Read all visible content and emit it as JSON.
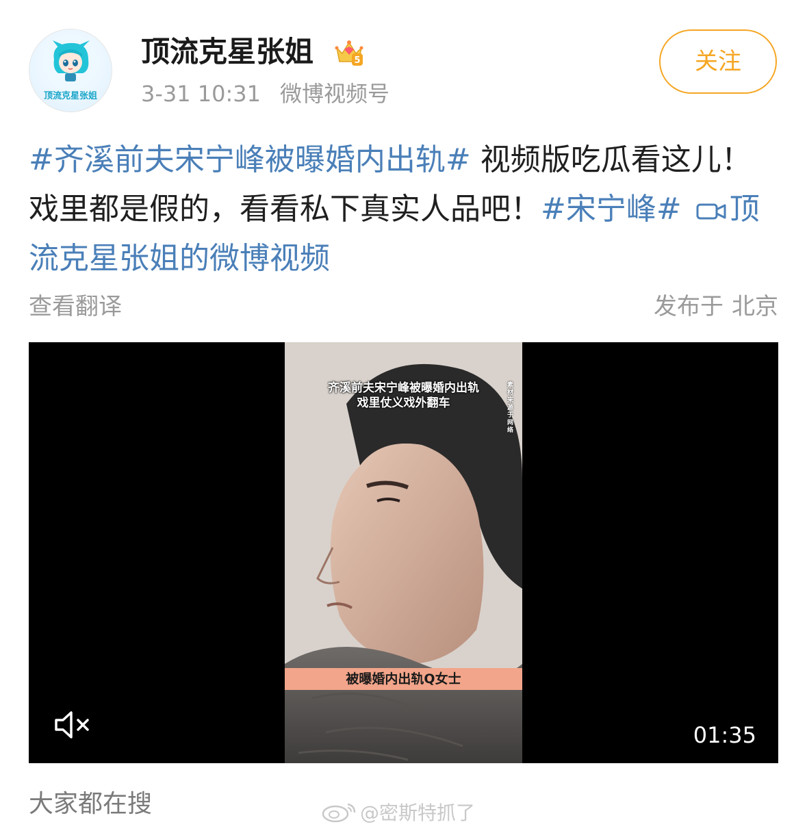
{
  "post": {
    "user": {
      "name": "顶流克星张姐",
      "avatar_text": "顶流克星张姐",
      "badge_level": "5"
    },
    "time": "3-31 10:31",
    "source": "微博视频号",
    "follow_label": "关注",
    "text": {
      "topic1": "#齐溪前夫宋宁峰被曝婚内出轨#",
      "body": " 视频版吃瓜看这儿！戏里都是假的，看看私下真实人品吧！",
      "topic2": "#宋宁峰#",
      "video_link": "顶流克星张姐的微博视频"
    },
    "translate_label": "查看翻译",
    "location_prefix": "发布于",
    "location_city": "北京"
  },
  "video": {
    "caption_line1": "齐溪前夫宋宁峰被曝婚内出轨",
    "caption_line2": "戏里仗义戏外翻车",
    "side_text": "素材来源于网络",
    "banner": "被曝婚内出轨Q女士",
    "duration": "01:35",
    "muted": true
  },
  "footer": {
    "search_label": "大家都在搜",
    "watermark": "@密斯特抓了"
  },
  "colors": {
    "link": "#4a7fb8",
    "follow": "#f5a623",
    "meta": "#9a9a9a",
    "banner": "#f2a58a"
  },
  "icons": {
    "badge": "crown-badge-icon",
    "video_link": "video-camera-icon",
    "mute": "muted-speaker-icon",
    "watermark": "weibo-logo-icon"
  }
}
